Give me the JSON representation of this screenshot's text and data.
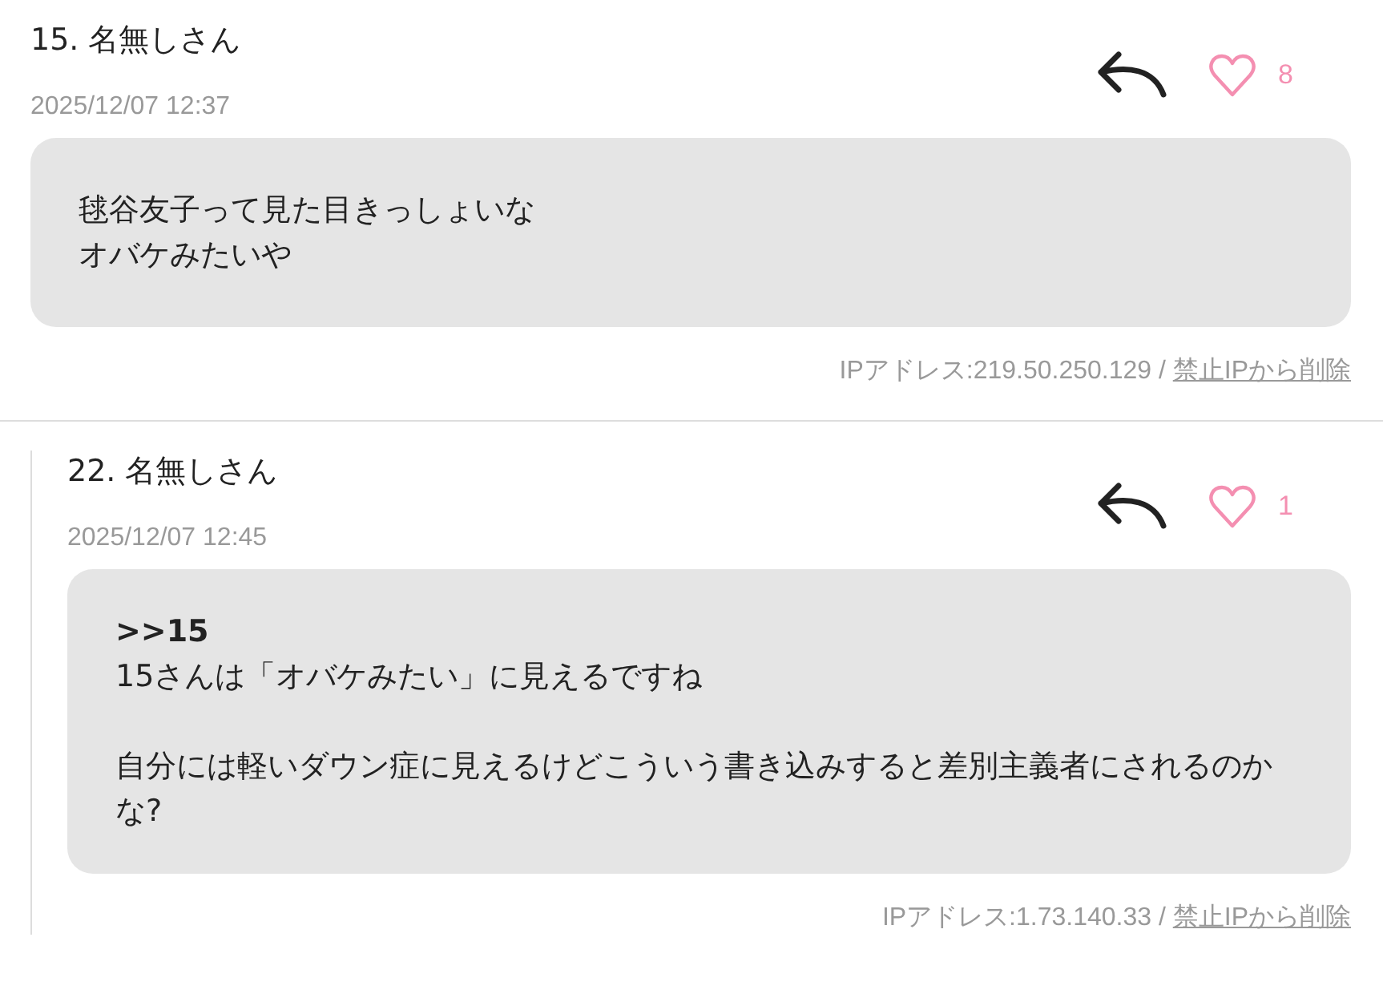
{
  "posts": [
    {
      "number": "15.",
      "name": "名無しさん",
      "date": "2025/12/07 12:37",
      "likes": "8",
      "nested": false,
      "paragraphs": [
        {
          "lines": [
            {
              "kind": "text",
              "text": "毬谷友子って見た目きっしょいな"
            },
            {
              "kind": "text",
              "text": "オバケみたいや"
            }
          ]
        }
      ],
      "ip": "IPアドレス:219.50.250.129 /",
      "ban_link": "禁止IPから削除"
    },
    {
      "number": "22.",
      "name": "名無しさん",
      "date": "2025/12/07 12:45",
      "likes": "1",
      "nested": true,
      "paragraphs": [
        {
          "lines": [
            {
              "kind": "anchor",
              "text": ">>15"
            },
            {
              "kind": "text",
              "text": "15さんは「オバケみたい」に見えるですね"
            }
          ]
        },
        {
          "lines": [
            {
              "kind": "text",
              "text": "自分には軽いダウン症に見えるけどこういう書き込みすると差別主義者にされるのかな?"
            }
          ]
        }
      ],
      "ip": "IPアドレス:1.73.140.33 /",
      "ban_link": "禁止IPから削除"
    }
  ]
}
